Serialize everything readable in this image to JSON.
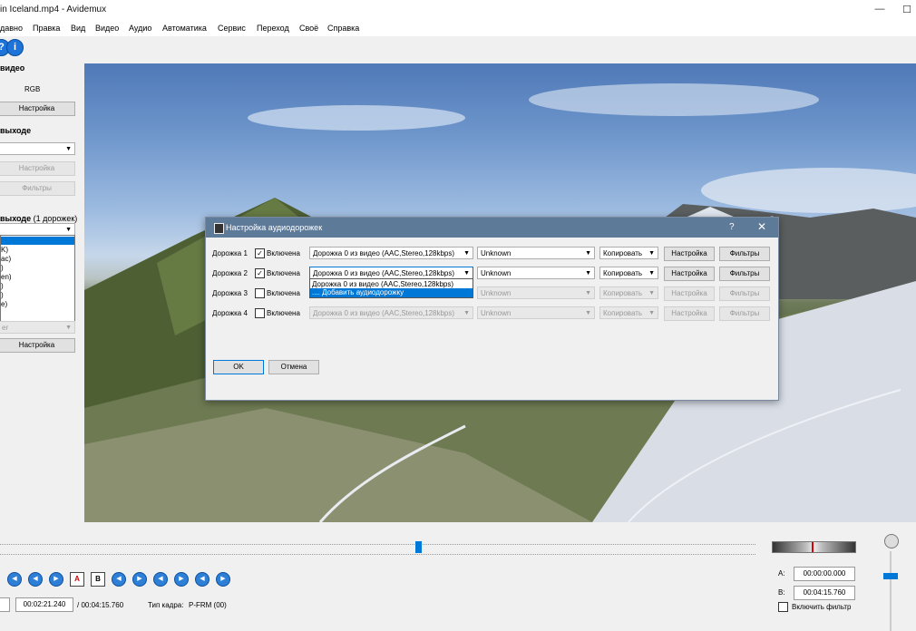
{
  "window": {
    "title": "in Iceland.mp4 - Avidemux",
    "minimize": "—",
    "maximize": "☐"
  },
  "menu": [
    "давно",
    "Правка",
    "Вид",
    "Видео",
    "Аудио",
    "Автоматика",
    "Сервис",
    "Переход",
    "Своё",
    "Справка"
  ],
  "left_panel": {
    "video_header": "видео",
    "video_codec": "RGB",
    "video_config_button": "Настройка",
    "output_header": "выходе",
    "output_config_button": "Настройка",
    "output_filters_button": "Фильтры",
    "audio_header": "выходе",
    "audio_tracks_count": "(1 дорожек)",
    "audio_list_items": [
      "",
      "K)",
      "ac)",
      ")",
      "en)",
      ")",
      ")",
      "e)"
    ],
    "muxer_value": "er",
    "muxer_config_button": "Настройка"
  },
  "dialog": {
    "title": "Настройка аудиодорожек",
    "help": "?",
    "close": "✕",
    "enabled_label": "Включена",
    "tracks": [
      {
        "label": "Дорожка 1",
        "checked": true,
        "source": "Дорожка 0 из видео (AAC,Stereo,128kbps)",
        "lang": "Unknown",
        "codec": "Копировать",
        "config": "Настройка",
        "filters": "Фильтры"
      },
      {
        "label": "Дорожка 2",
        "checked": true,
        "source": "Дорожка 0 из видео (AAC,Stereo,128kbps)",
        "lang": "Unknown",
        "codec": "Копировать",
        "config": "Настройка",
        "filters": "Фильтры"
      },
      {
        "label": "Дорожка 3",
        "checked": false,
        "source": "",
        "lang": "Unknown",
        "codec": "Копировать",
        "config": "Настройка",
        "filters": "Фильтры"
      },
      {
        "label": "Дорожка 4",
        "checked": false,
        "source": "Дорожка 0 из видео (AAC,Stereo,128kbps)",
        "lang": "Unknown",
        "codec": "Копировать",
        "config": "Настройка",
        "filters": "Фильтры"
      }
    ],
    "dropdown_options": [
      "Дорожка 0 из видео (AAC,Stereo,128kbps)",
      ".... Добавить аудиодорожку"
    ],
    "ok": "OK",
    "cancel": "Отмена"
  },
  "bottom": {
    "current_time": "00:02:21.240",
    "total_time": "/ 00:04:15.760",
    "frame_type_label": "Тип кадра:",
    "frame_type_value": "P-FRM (00)",
    "marker_a_label": "A:",
    "marker_a_value": "00:00:00.000",
    "marker_b_label": "B:",
    "marker_b_value": "00:04:15.760",
    "enable_filter_label": "Включить фильтр",
    "position_fraction": 0.553,
    "nav_icons": [
      "rewind-icon",
      "prev-keyframe-icon",
      "next-keyframe-icon",
      "marker-a-icon",
      "marker-b-icon",
      "prev-frame-icon",
      "next-frame-icon",
      "back-one-minute-icon",
      "forward-one-minute-icon",
      "prev-black-icon",
      "next-black-icon"
    ],
    "nav_glyphs": {
      "a": "A",
      "b": "B"
    }
  }
}
